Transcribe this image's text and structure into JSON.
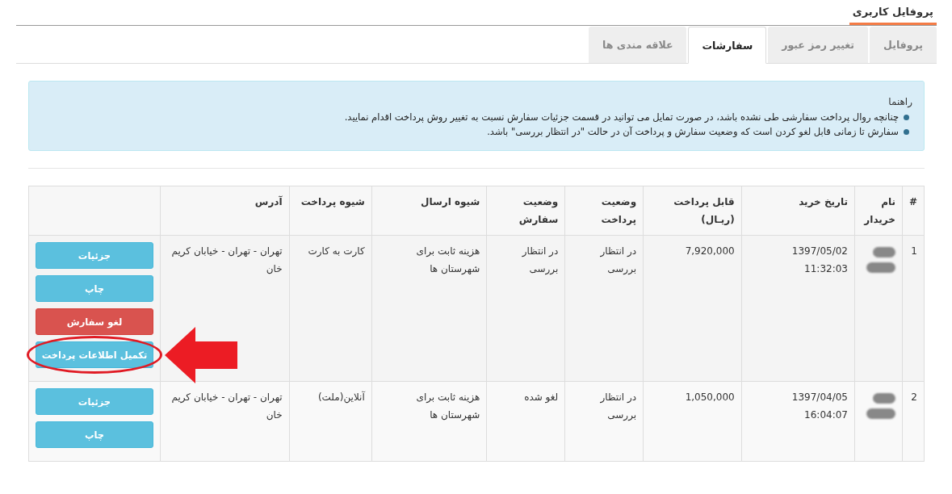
{
  "page_title": "پروفایل کاربری",
  "tabs": [
    {
      "label": "پروفایل",
      "selected": false
    },
    {
      "label": "تغییر رمز عبور",
      "selected": false
    },
    {
      "label": "سفارشات",
      "selected": true
    },
    {
      "label": "علاقه مندی ها",
      "selected": false
    }
  ],
  "guide": {
    "title": "راهنما",
    "items": [
      "چنانچه روال پرداخت سفارشی طی نشده باشد، در صورت تمایل می توانید در قسمت جزئیات سفارش نسبت به تغییر روش پرداخت اقدام نمایید.",
      "سفارش تا زمانی قابل لغو کردن است که وضعیت سفارش و پرداخت آن در حالت \"در انتظار بررسی\" باشد."
    ]
  },
  "table": {
    "columns": [
      "#",
      "نام خریدار",
      "تاریخ خرید",
      "قابل پرداخت (ریـال)",
      "وضعیت پرداخت",
      "وضعیت سفارش",
      "شیوه ارسال",
      "شیوه پرداخت",
      "آدرس"
    ],
    "rows": [
      {
        "number": "1",
        "date": "1397/05/02",
        "time": "11:32:03",
        "amount": "7,920,000",
        "payment_status": "در انتظار بررسی",
        "order_status": "در انتظار بررسی",
        "shipping": "هزینه ثابت برای شهرستان ها",
        "payment_method": "کارت به کارت",
        "address": "تهران - تهران - خیابان کریم خان",
        "actions": [
          {
            "label": "جزئیات",
            "kind": "info",
            "highlighted": false
          },
          {
            "label": "چاپ",
            "kind": "info",
            "highlighted": false
          },
          {
            "label": "لغو سفارش",
            "kind": "danger",
            "highlighted": false
          },
          {
            "label": "تکمیل اطلاعات پرداخت",
            "kind": "info",
            "highlighted": true
          }
        ]
      },
      {
        "number": "2",
        "date": "1397/04/05",
        "time": "16:04:07",
        "amount": "1,050,000",
        "payment_status": "در انتظار بررسی",
        "order_status": "لغو شده",
        "shipping": "هزینه ثابت برای شهرستان ها",
        "payment_method": "آنلاین(ملت)",
        "address": "تهران - تهران - خیابان کریم خان",
        "actions": [
          {
            "label": "جزئیات",
            "kind": "info",
            "highlighted": false
          },
          {
            "label": "چاپ",
            "kind": "info",
            "highlighted": false
          }
        ]
      }
    ]
  }
}
